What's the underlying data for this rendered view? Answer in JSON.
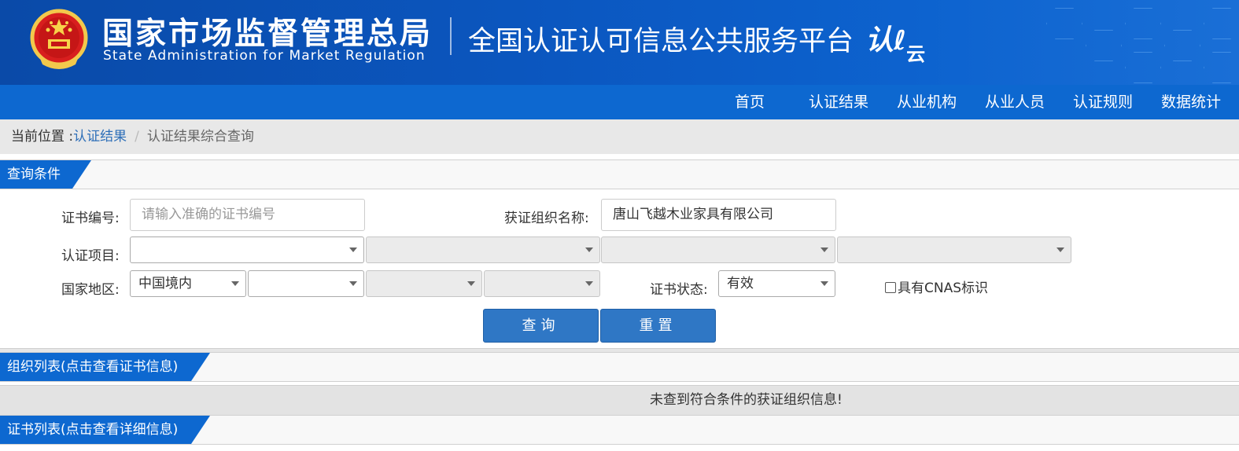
{
  "header": {
    "agency_cn": "国家市场监督管理总局",
    "agency_en": "State Administration  for  Market Regulation",
    "platform_title": "全国认证认可信息公共服务平台",
    "logo_text_main": "认",
    "logo_text_sub": "云"
  },
  "nav": {
    "items": [
      "首页",
      "认证结果",
      "从业机构",
      "从业人员",
      "认证规则",
      "数据统计"
    ]
  },
  "breadcrumb": {
    "prefix": "当前位置 :",
    "link": "认证结果",
    "separator": "/",
    "current": "认证结果综合查询"
  },
  "query_section": {
    "title": "查询条件"
  },
  "form": {
    "cert_no_label": "证书编号:",
    "cert_no_placeholder": "请输入准确的证书编号",
    "org_name_label": "获证组织名称:",
    "org_name_value": "唐山飞越木业家具有限公司",
    "project_label": "认证项目:",
    "project_selects": [
      "",
      "",
      "",
      ""
    ],
    "region_label": "国家地区:",
    "region_selects": [
      "中国境内",
      "",
      "",
      ""
    ],
    "status_label": "证书状态:",
    "status_value": "有效",
    "cnas_label": "具有CNAS标识",
    "cnas_checked": false,
    "search_button": "查询",
    "reset_button": "重置"
  },
  "org_list": {
    "title": "组织列表(点击查看证书信息)",
    "empty_message": "未查到符合条件的获证组织信息!"
  },
  "cert_list": {
    "title": "证书列表(点击查看详细信息)"
  },
  "colors": {
    "banner_blue": "#0b57c0",
    "nav_blue": "#0d68d0",
    "button_blue": "#2f77c5",
    "link_blue": "#2e6fb8"
  }
}
